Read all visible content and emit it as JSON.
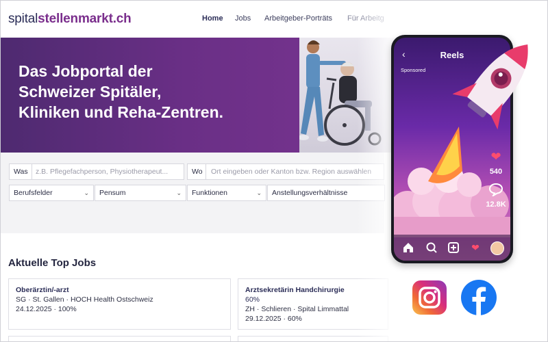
{
  "header": {
    "logo_a": "spital",
    "logo_b": "stellenmarkt.ch",
    "nav": [
      "Home",
      "Jobs",
      "Arbeitgeber-Porträts",
      "Für Arbeitg"
    ]
  },
  "hero": {
    "headline_1": "Das Jobportal der",
    "headline_2": "Schweizer Spitäler,",
    "headline_3": "Kliniken und Reha-Zentren."
  },
  "search": {
    "was_label": "Was",
    "was_placeholder": "z.B. Pflegefachperson, Physiotherapeut...",
    "wo_label": "Wo",
    "wo_placeholder": "Ort eingeben oder Kanton bzw. Region auswählen",
    "filters": [
      "Berufsfelder",
      "Pensum",
      "Funktionen",
      "Anstellungsverhältnisse"
    ]
  },
  "jobs": {
    "title": "Aktuelle Top Jobs",
    "cards": [
      {
        "title": "Oberärztin/-arzt",
        "line1": "SG · St. Gallen · HOCH Health Ostschweiz",
        "line2": "24.12.2025 · 100%"
      },
      {
        "title": "Arztsekretärin Handchirurgie",
        "title2": "60%",
        "line1": "ZH · Schlieren · Spital Limmattal",
        "line2": "29.12.2025 · 60%"
      }
    ]
  },
  "phone": {
    "back": "‹",
    "title": "Reels",
    "sponsored": "Sponsored",
    "likes": "540",
    "comments": "12.8K"
  },
  "colors": {
    "brand_purple": "#7a2e8c",
    "navy": "#2b2d57",
    "hero_gradient_start": "#4e2a70",
    "facebook_blue": "#1877f2"
  },
  "icons": {
    "bottom_bar": [
      "home-icon",
      "search-icon",
      "add-icon",
      "heart-icon",
      "avatar"
    ],
    "social": [
      "instagram-icon",
      "facebook-icon"
    ]
  }
}
